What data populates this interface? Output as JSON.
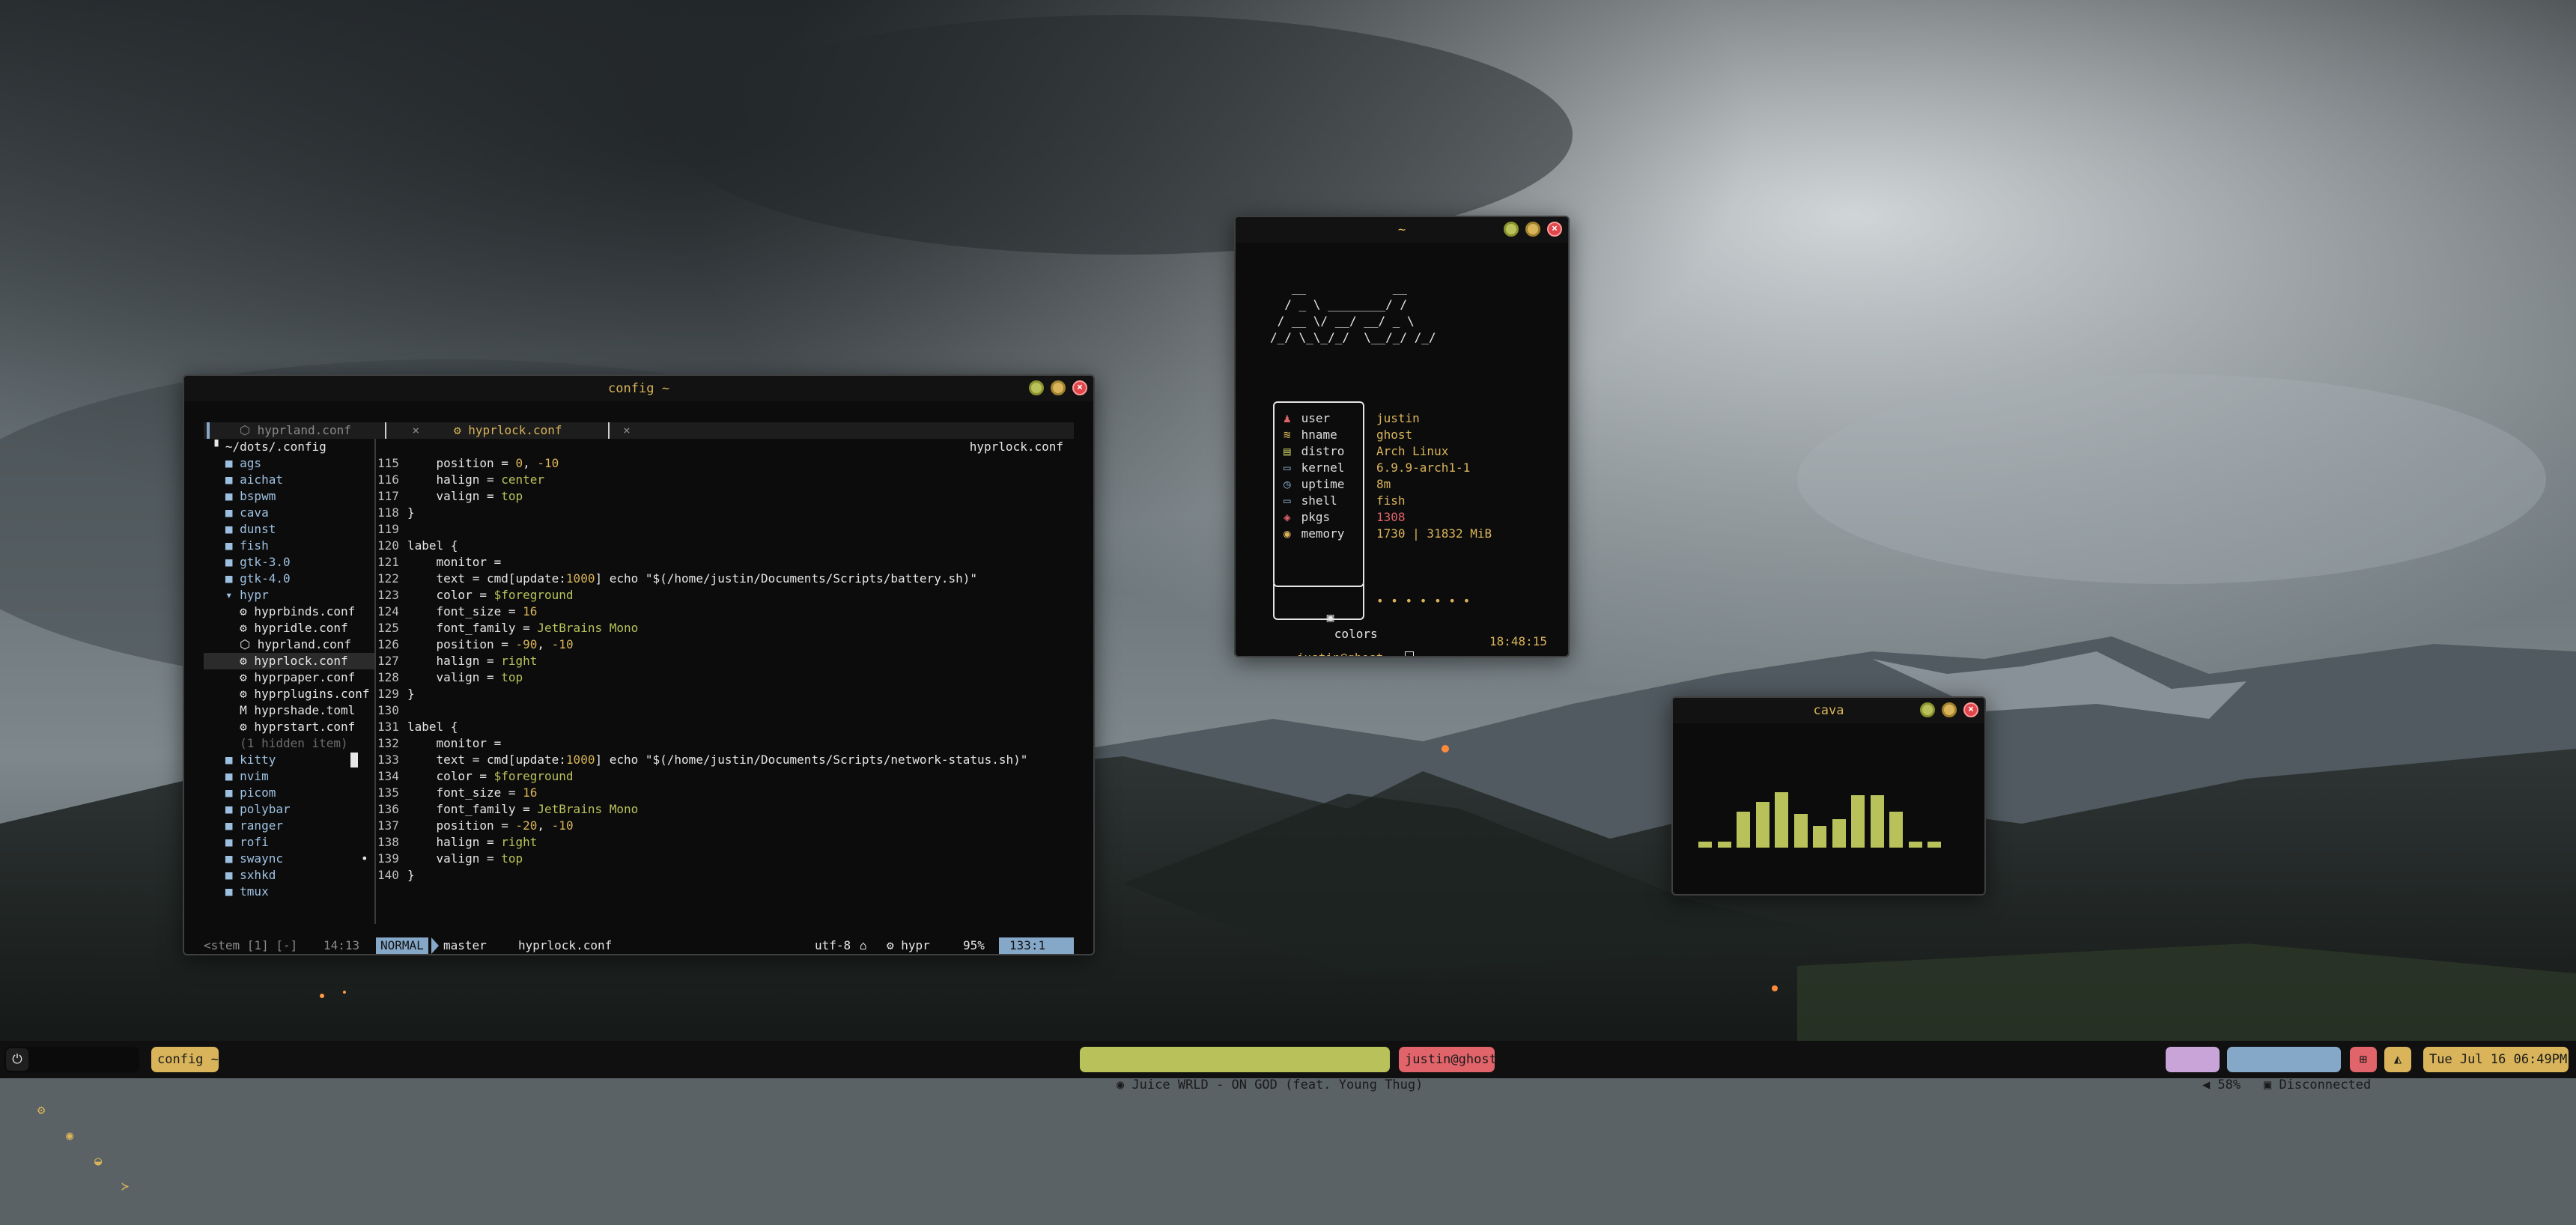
{
  "colors": {
    "accent_yellow": "#d9b45a",
    "accent_green": "#b9c25a",
    "accent_red": "#e0464b",
    "accent_blue": "#86a8c8",
    "accent_purple": "#c9a4d8",
    "terminal_bg": "#0c0c0c"
  },
  "nvim": {
    "title": "config ~",
    "tabs": [
      {
        "icon": "gear-icon",
        "glyph": "⬡",
        "name": "hyprland.conf",
        "close": "×"
      },
      {
        "icon": "gear-icon",
        "glyph": "⚙",
        "name": "hyprlock.conf",
        "close": "×"
      }
    ],
    "winbar": "hyprlock.conf",
    "tree": [
      {
        "text": " ▝ ~/dots/.config",
        "kind": "root"
      },
      {
        "text": "   ■ ags",
        "kind": "dir"
      },
      {
        "text": "   ■ aichat",
        "kind": "dir"
      },
      {
        "text": "   ■ bspwm",
        "kind": "dir"
      },
      {
        "text": "   ■ cava",
        "kind": "dir"
      },
      {
        "text": "   ■ dunst",
        "kind": "dir"
      },
      {
        "text": "   ■ fish",
        "kind": "dir"
      },
      {
        "text": "   ■ gtk-3.0",
        "kind": "dir"
      },
      {
        "text": "   ■ gtk-4.0",
        "kind": "dir"
      },
      {
        "text": "   ▾ hypr",
        "kind": "dir"
      },
      {
        "text": "     ⚙ hyprbinds.conf",
        "kind": "file"
      },
      {
        "text": "     ⚙ hypridle.conf",
        "kind": "file"
      },
      {
        "text": "     ⬡ hyprland.conf",
        "kind": "file"
      },
      {
        "text": "     ⚙ hyprlock.conf",
        "kind": "selected"
      },
      {
        "text": "     ⚙ hyprpaper.conf",
        "kind": "file"
      },
      {
        "text": "     ⚙ hyprplugins.conf",
        "kind": "file"
      },
      {
        "text": "     M hyprshade.toml",
        "kind": "file"
      },
      {
        "text": "     ⚙ hyprstart.conf",
        "kind": "file"
      },
      {
        "text": "     (1 hidden item)",
        "kind": "hidden"
      },
      {
        "text": "   ■ kitty",
        "kind": "dir"
      },
      {
        "text": "   ■ nvim",
        "kind": "dir"
      },
      {
        "text": "   ■ picom",
        "kind": "dir"
      },
      {
        "text": "   ■ polybar",
        "kind": "dir"
      },
      {
        "text": "   ■ ranger",
        "kind": "dir"
      },
      {
        "text": "   ■ rofi",
        "kind": "dir"
      },
      {
        "text": "   ■ swaync",
        "kind": "dir",
        "mark": "•"
      },
      {
        "text": "   ■ sxhkd",
        "kind": "dir"
      },
      {
        "text": "   ■ tmux",
        "kind": "dir"
      }
    ],
    "tree_status": "<stem [1] [-]",
    "tree_pos": "14:13",
    "code": [
      {
        "n": "115",
        "parts": [
          {
            "t": "    position = "
          },
          {
            "t": "0",
            "c": "num"
          },
          {
            "t": ", "
          },
          {
            "t": "-10",
            "c": "num"
          }
        ]
      },
      {
        "n": "116",
        "parts": [
          {
            "t": "    halign = "
          },
          {
            "t": "center",
            "c": "str"
          }
        ]
      },
      {
        "n": "117",
        "parts": [
          {
            "t": "    valign = "
          },
          {
            "t": "top",
            "c": "str"
          }
        ]
      },
      {
        "n": "118",
        "parts": [
          {
            "t": "}"
          }
        ]
      },
      {
        "n": "119",
        "parts": [
          {
            "t": ""
          }
        ]
      },
      {
        "n": "120",
        "parts": [
          {
            "t": "label {"
          }
        ]
      },
      {
        "n": "121",
        "parts": [
          {
            "t": "    monitor ="
          }
        ]
      },
      {
        "n": "122",
        "parts": [
          {
            "t": "    text = cmd[update:"
          },
          {
            "t": "1000",
            "c": "num"
          },
          {
            "t": "] echo \"$(/home/justin/Documents/Scripts/battery.sh)\""
          }
        ]
      },
      {
        "n": "123",
        "parts": [
          {
            "t": "    color = "
          },
          {
            "t": "$foreground",
            "c": "var"
          }
        ]
      },
      {
        "n": "124",
        "parts": [
          {
            "t": "    font_size = "
          },
          {
            "t": "16",
            "c": "num"
          }
        ]
      },
      {
        "n": "125",
        "parts": [
          {
            "t": "    font_family = "
          },
          {
            "t": "JetBrains Mono",
            "c": "str"
          }
        ]
      },
      {
        "n": "126",
        "parts": [
          {
            "t": "    position = "
          },
          {
            "t": "-90",
            "c": "num"
          },
          {
            "t": ", "
          },
          {
            "t": "-10",
            "c": "num"
          }
        ]
      },
      {
        "n": "127",
        "parts": [
          {
            "t": "    halign = "
          },
          {
            "t": "right",
            "c": "str"
          }
        ]
      },
      {
        "n": "128",
        "parts": [
          {
            "t": "    valign = "
          },
          {
            "t": "top",
            "c": "str"
          }
        ]
      },
      {
        "n": "129",
        "parts": [
          {
            "t": "}"
          }
        ]
      },
      {
        "n": "130",
        "parts": [
          {
            "t": ""
          }
        ]
      },
      {
        "n": "131",
        "parts": [
          {
            "t": "label {"
          }
        ]
      },
      {
        "n": "132",
        "parts": [
          {
            "t": "    monitor ="
          }
        ]
      },
      {
        "n": "133",
        "parts": [
          {
            "t": "    text = cmd[update:"
          },
          {
            "t": "1000",
            "c": "num"
          },
          {
            "t": "] echo \"$(/home/justin/Documents/Scripts/network-status.sh)\""
          }
        ],
        "cursor": true
      },
      {
        "n": "134",
        "parts": [
          {
            "t": "    color = "
          },
          {
            "t": "$foreground",
            "c": "var"
          }
        ]
      },
      {
        "n": "135",
        "parts": [
          {
            "t": "    font_size = "
          },
          {
            "t": "16",
            "c": "num"
          }
        ]
      },
      {
        "n": "136",
        "parts": [
          {
            "t": "    font_family = "
          },
          {
            "t": "JetBrains Mono",
            "c": "str"
          }
        ]
      },
      {
        "n": "137",
        "parts": [
          {
            "t": "    position = "
          },
          {
            "t": "-20",
            "c": "num"
          },
          {
            "t": ", "
          },
          {
            "t": "-10",
            "c": "num"
          }
        ]
      },
      {
        "n": "138",
        "parts": [
          {
            "t": "    halign = "
          },
          {
            "t": "right",
            "c": "str"
          }
        ]
      },
      {
        "n": "139",
        "parts": [
          {
            "t": "    valign = "
          },
          {
            "t": "top",
            "c": "str"
          }
        ]
      },
      {
        "n": "140",
        "parts": [
          {
            "t": "}"
          }
        ]
      }
    ],
    "status": {
      "mode": "NORMAL",
      "branch": " master",
      "file": "hyprlock.conf",
      "encoding": "utf-8",
      "os_glyph": "⌂",
      "filetype": "⚙ hypr",
      "percent": "95%",
      "position": "133:1"
    }
  },
  "fastfetch": {
    "title": "~",
    "ascii": "   __            __\n  / _ \\ ________/ /\n / __ \\/ __/ __/ _ \\\n/_/ \\_\\_/_/  \\__/_/ /_/",
    "rows": [
      {
        "icon": "user-icon",
        "glyph": "♟",
        "label": "user",
        "value": "justin"
      },
      {
        "icon": "host-icon",
        "glyph": "≋",
        "label": "hname",
        "value": "ghost"
      },
      {
        "icon": "distro-icon",
        "glyph": "▤",
        "label": "distro",
        "value": "Arch Linux"
      },
      {
        "icon": "kernel-icon",
        "glyph": "▭",
        "label": "kernel",
        "value": "6.9.9-arch1-1"
      },
      {
        "icon": "uptime-icon",
        "glyph": "◷",
        "label": "uptime",
        "value": "8m"
      },
      {
        "icon": "shell-icon",
        "glyph": "▭",
        "label": "shell",
        "value": "fish"
      },
      {
        "icon": "package-icon",
        "glyph": "◈",
        "label": "pkgs",
        "value": "1308"
      },
      {
        "icon": "memory-icon",
        "glyph": "◉",
        "label": "memory",
        "value": "1730 | 31832 MiB"
      }
    ],
    "colors_label": "colors",
    "colors_dots": "• • • • • • •",
    "prompt": "justin@ghost → ",
    "time": "18:48:15"
  },
  "cava": {
    "title": "cava",
    "levels": [
      0.05,
      0.05,
      0.3,
      0.38,
      0.46,
      0.28,
      0.18,
      0.24,
      0.44,
      0.44,
      0.3,
      0.05,
      0.05
    ]
  },
  "taskbar": {
    "left_icons": [
      "power-icon",
      "settings-icon",
      "menu-icon",
      "browser-icon",
      "terminal-icon"
    ],
    "left_glyphs": [
      "⏻",
      "⚙",
      "◉",
      "◒",
      "≻"
    ],
    "window_label": "config ~",
    "media": "Juice WRLD - ON GOD (feat. Young Thug)",
    "user": "justin@ghost",
    "volume": "58%",
    "network": "Disconnected",
    "datetime": "Tue Jul 16 06:49PM"
  }
}
